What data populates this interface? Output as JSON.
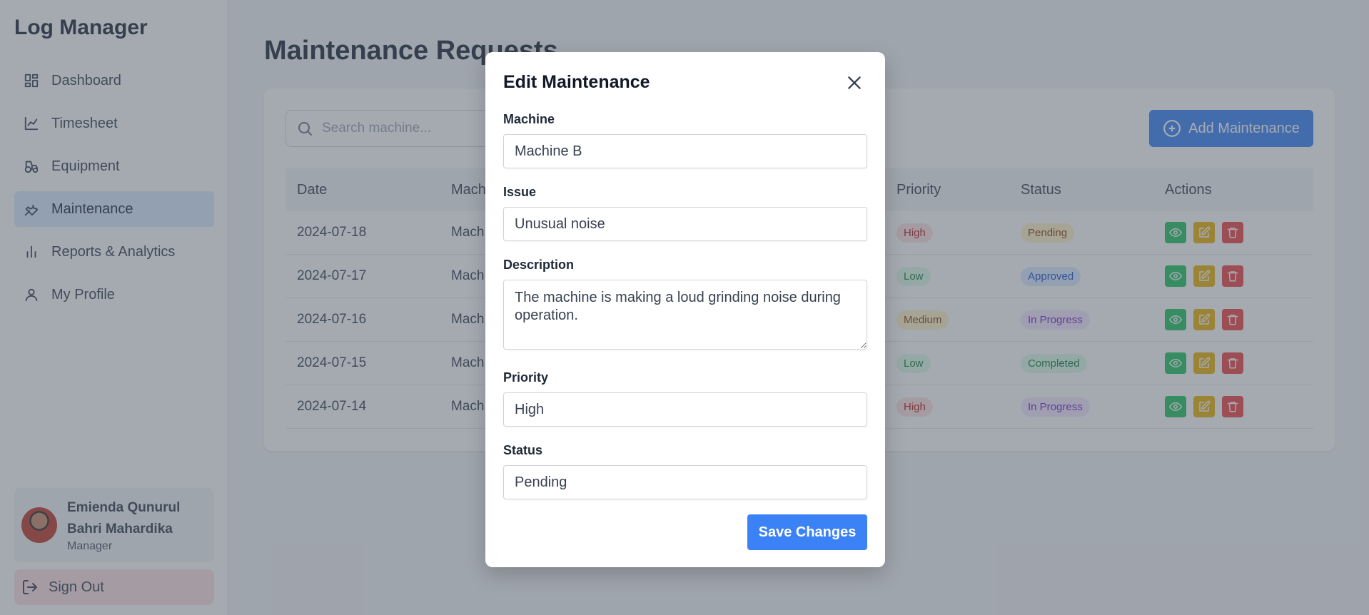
{
  "app": {
    "title": "Log Manager"
  },
  "sidebar": {
    "items": [
      {
        "label": "Dashboard",
        "icon": "dashboard-icon"
      },
      {
        "label": "Timesheet",
        "icon": "chart-line-icon"
      },
      {
        "label": "Equipment",
        "icon": "tractor-icon"
      },
      {
        "label": "Maintenance",
        "icon": "wrench-icon",
        "active": true
      },
      {
        "label": "Reports & Analytics",
        "icon": "bar-chart-icon"
      },
      {
        "label": "My Profile",
        "icon": "user-icon"
      }
    ],
    "user": {
      "name": "Emienda Qunurul Bahri Mahardika",
      "role": "Manager"
    },
    "signout_label": "Sign Out"
  },
  "main": {
    "title": "Maintenance Requests",
    "search_placeholder": "Search machine...",
    "add_label": "Add Maintenance",
    "columns": [
      "Date",
      "Machine",
      "Priority",
      "Status",
      "Actions"
    ],
    "rows": [
      {
        "date": "2024-07-18",
        "machine": "Mach",
        "priority": "High",
        "status": "Pending"
      },
      {
        "date": "2024-07-17",
        "machine": "Mach",
        "priority": "Low",
        "status": "Approved"
      },
      {
        "date": "2024-07-16",
        "machine": "Mach",
        "priority": "Medium",
        "status": "In Progress"
      },
      {
        "date": "2024-07-15",
        "machine": "Mach",
        "priority": "Low",
        "status": "Completed"
      },
      {
        "date": "2024-07-14",
        "machine": "Mach",
        "priority": "High",
        "status": "In Progress"
      }
    ]
  },
  "modal": {
    "title": "Edit Maintenance",
    "machine_label": "Machine",
    "machine_value": "Machine B",
    "issue_label": "Issue",
    "issue_value": "Unusual noise",
    "description_label": "Description",
    "description_value": "The machine is making a loud grinding noise during operation.",
    "priority_label": "Priority",
    "priority_value": "High",
    "status_label": "Status",
    "status_value": "Pending",
    "save_label": "Save Changes"
  },
  "colors": {
    "primary": "#3b82f6",
    "active_nav": "#dbeafe",
    "signout_bg": "#fee2e2",
    "view": "#22c55e",
    "edit": "#eab308",
    "delete": "#ef4444"
  }
}
